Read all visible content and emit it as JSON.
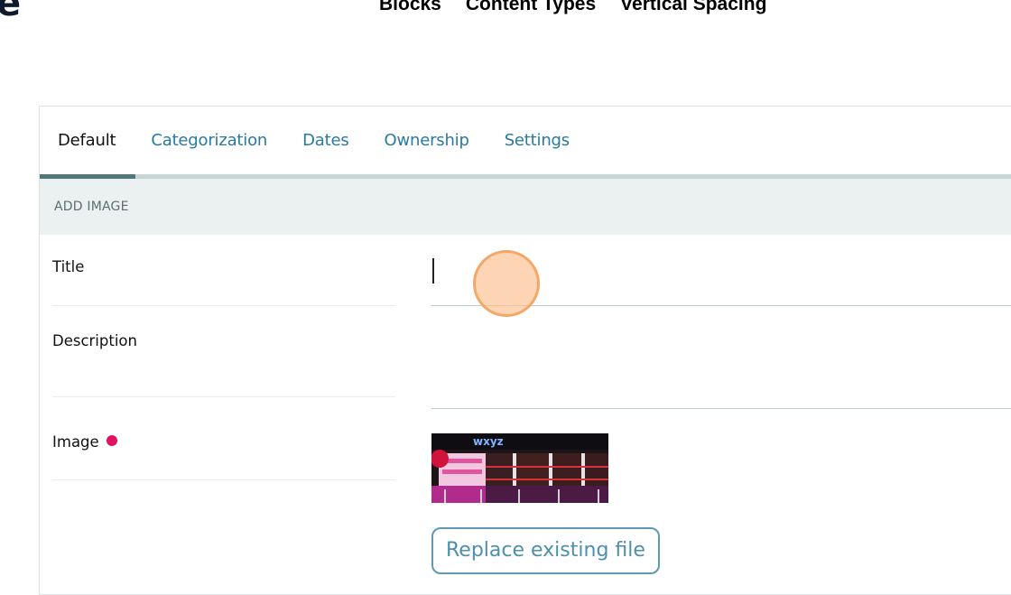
{
  "header": {
    "logo_fragment": "e",
    "nav": [
      "Blocks",
      "Content Types",
      "Vertical Spacing"
    ]
  },
  "tabs": [
    {
      "label": "Default",
      "active": true
    },
    {
      "label": "Categorization",
      "active": false
    },
    {
      "label": "Dates",
      "active": false
    },
    {
      "label": "Ownership",
      "active": false
    },
    {
      "label": "Settings",
      "active": false
    }
  ],
  "section": {
    "title": "ADD IMAGE"
  },
  "form": {
    "title": {
      "label": "Title",
      "value": ""
    },
    "description": {
      "label": "Description",
      "value": ""
    },
    "image": {
      "label": "Image",
      "required": true,
      "preview_alt": "Bar interior with neon wxyz sign",
      "sign_text": "wxyz",
      "replace_button": "Replace existing file"
    }
  },
  "colors": {
    "accent": "#2a7aa0",
    "tab_indicator": "#50777a",
    "required": "#e0115f",
    "section_bg": "#ebf0f1",
    "button_border": "#5f98b3"
  }
}
